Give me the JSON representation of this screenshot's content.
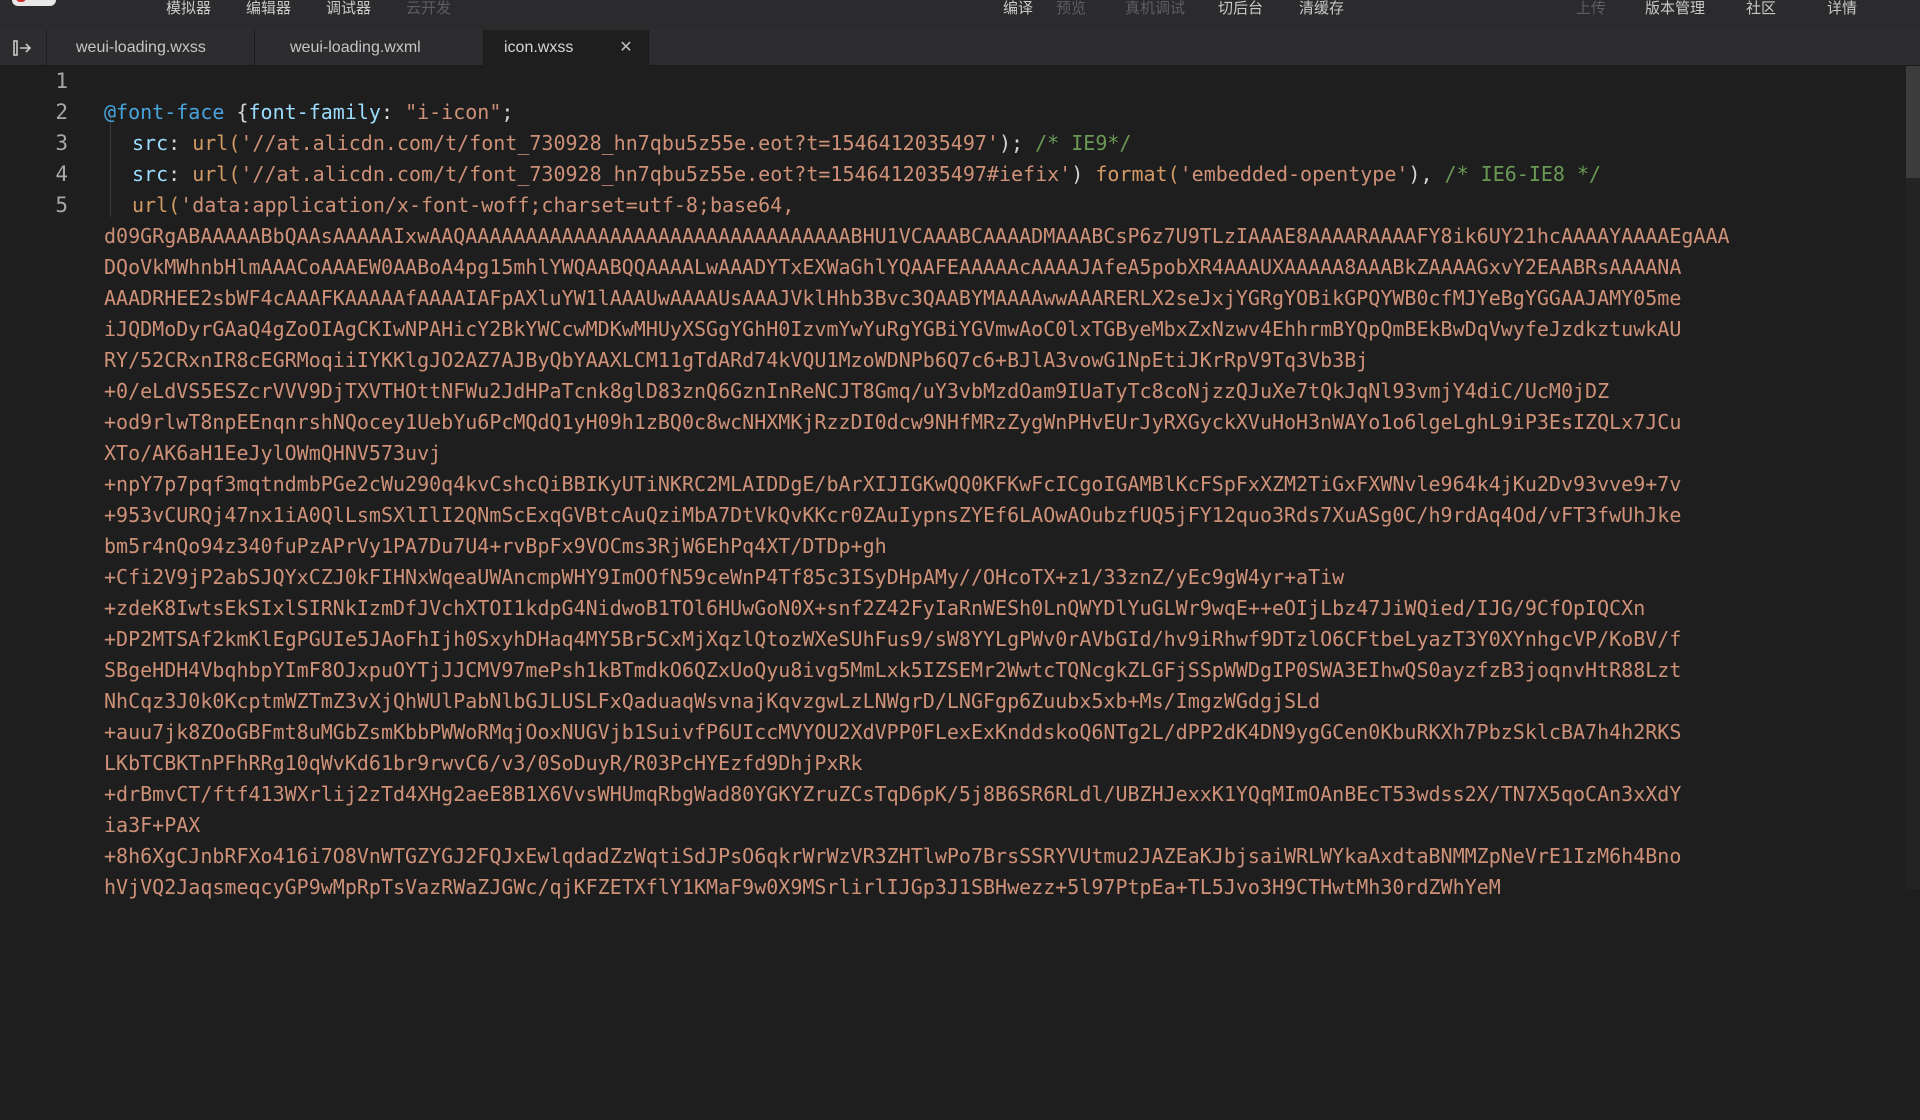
{
  "toolbar": {
    "items": [
      {
        "label": "模拟器",
        "enabled": true
      },
      {
        "label": "编辑器",
        "enabled": true
      },
      {
        "label": "调试器",
        "enabled": true
      },
      {
        "label": "云开发",
        "enabled": false
      },
      {
        "label": "编译",
        "enabled": true
      },
      {
        "label": "预览",
        "enabled": false
      },
      {
        "label": "真机调试",
        "enabled": false
      },
      {
        "label": "切后台",
        "enabled": true
      },
      {
        "label": "清缓存",
        "enabled": true
      },
      {
        "label": "上传",
        "enabled": false
      },
      {
        "label": "版本管理",
        "enabled": true
      },
      {
        "label": "社区",
        "enabled": true
      },
      {
        "label": "详情",
        "enabled": true
      }
    ]
  },
  "tabs": [
    {
      "label": "weui-loading.wxss",
      "active": false
    },
    {
      "label": "weui-loading.wxml",
      "active": false
    },
    {
      "label": "icon.wxss",
      "active": true
    }
  ],
  "tab_close_glyph": "✕",
  "line_numbers": [
    "1",
    "2",
    "3",
    "4",
    "5"
  ],
  "code": {
    "line2": {
      "at": "@font-face",
      "brace": " {",
      "prop": "font-family",
      "colon": ": ",
      "value": "\"i-icon\"",
      "end": ";"
    },
    "line3": {
      "prop": "src",
      "colon": ": ",
      "fn": "url(",
      "str": "'//at.alicdn.com/t/font_730928_hn7qbu5z55e.eot?t=1546412035497'",
      "close": "); ",
      "comment": "/* IE9*/"
    },
    "line4": {
      "prop": "src",
      "colon": ": ",
      "fn": "url(",
      "str": "'//at.alicdn.com/t/font_730928_hn7qbu5z55e.eot?t=1546412035497#iefix'",
      "close": ") ",
      "fn2": "format(",
      "str2": "'embedded-opentype'",
      "close2": "), ",
      "comment": "/* IE6-IE8 */"
    },
    "line5": {
      "fn": "url(",
      "str": "'data:application/x-font-woff;charset=utf-8;base64,"
    },
    "base64": [
      "d09GRgABAAAAABbQAAsAAAAAIxwAAQAAAAAAAAAAAAAAAAAAAAAAAAAAAAAAAABHU1VCAAABCAAAADMAAABCsP6z7U9TLzIAAAE8AAAARAAAAFY8ik6UY21hcAAAAYAAAAEgAAA",
      "DQoVkMWhnbHlmAAACoAAAEW0AABoA4pg15mhlYWQAABQQAAAALwAAADYTxEXWaGhlYQAAFEAAAAAcAAAAJAfeA5pobXR4AAAUXAAAAA8AAABkZAAAAGxvY2EAABRsAAAANA",
      "AAADRHEE2sbWF4cAAAFKAAAAAfAAAAIAFpAXluYW1lAAAUwAAAAUsAAAJVklHhb3Bvc3QAABYMAAAAwwAAARERLX2seJxjYGRgYOBikGPQYWB0cfMJYeBgYGGAAJAMY05me",
      "iJQDMoDyrGAaQ4gZoOIAgCKIwNPAHicY2BkYWCcwMDKwMHUyXSGgYGhH0IzvmYwYuRgYGBiYGVmwAoC0lxTGByeMbxZxNzwv4EhhrmBYQpQmBEkBwDqVwyfeJzdkztuwkAU",
      "RY/52CRxnIR8cEGRMoqiiIYKKlgJO2AZ7AJByQbYAAXLCM11gTdARd74kVQU1MzoWDNPb6Q7c6+BJlA3vowG1NpEtiJKrRpV9Tq3Vb3Bj",
      "+0/eLdVS5ESZcrVVV9DjTXVTHOttNFWu2JdHPaTcnk8glD83znQ6GznInReNCJT8Gmq/uY3vbMzdOam9IUaTyTc8coNjzzQJuXe7tQkJqNl93vmjY4diC/UcM0jDZ",
      "+od9rlwT8npEEnqnrshNQocey1UebYu6PcMQdQ1yH09h1zBQ0c8wcNHXMKjRzzDI0dcw9NHfMRzZygWnPHvEUrJyRXGyckXVuHoH3nWAYo1o6lgeLghL9iP3EsIZQLx7JCu",
      "XTo/AK6aH1EeJylOWmQHNV573uvj",
      "+npY7p7pqf3mqtndmbPGe2cWu290q4kvCshcQiBBIKyUTiNKRC2MLAIDDgE/bArXIJIGKwQQ0KFKwFcICgoIGAMBlKcFSpFxXZM2TiGxFXWNvle964k4jKu2Dv93vve9+7v",
      "+953vCURQj47nx1iA0QlLsmSXlIlI2QNmScExqGVBtcAuQziMbA7DtVkQvKKcr0ZAuIypnsZYEf6LAOwAOubzfUQ5jFY12quo3Rds7XuASg0C/h9rdAq4Od/vFT3fwUhJke",
      "bm5r4nQo94z340fuPzAPrVy1PA7Du7U4+rvBpFx9VOCms3RjW6EhPq4XT/DTDp+gh",
      "+Cfi2V9jP2abSJQYxCZJ0kFIHNxWqeaUWAncmpWHY9ImOOfN59ceWnP4Tf85c3ISyDHpAMy//OHcoTX+z1/33znZ/yEc9gW4yr+aTiw",
      "+zdeK8IwtsEkSIxlSIRNkIzmDfJVchXTOI1kdpG4NidwoB1TOl6HUwGoN0X+snf2Z42FyIaRnWESh0LnQWYDlYuGLWr9wqE++eOIjLbz47JiWQied/IJG/9CfOpIQCXn",
      "+DP2MTSAf2kmKlEgPGUIe5JAoFhIjh0SxyhDHaq4MY5Br5CxMjXqzlQtozWXeSUhFus9/sW8YYLgPWv0rAVbGId/hv9iRhwf9DTzlO6CFtbeLyazT3Y0XYnhgcVP/KoBV/f",
      "SBgeHDH4VbqhbpYImF8OJxpuOYTjJJCMV97mePsh1kBTmdkO6QZxUoQyu8ivg5MmLxk5IZSEMr2WwtcTQNcgkZLGFjSSpWWDgIP0SWA3EIhwQS0ayzfzB3joqnvHtR88Lzt",
      "NhCqz3J0k0KcptmWZTmZ3vXjQhWUlPabNlbGJLUSLFxQaduaqWsvnajKqvzgwLzLNWgrD/LNGFgp6Zuubx5xb+Ms/ImgzWGdgjSLd",
      "+auu7jk8ZOoGBFmt8uMGbZsmKbbPWWoRMqjOoxNUGVjb1SuivfP6UIccMVYOU2XdVPP0FLexExKnddskoQ6NTg2L/dPP2dK4DN9ygGCen0KbuRKXh7PbzSklcBA7h4h2RKS",
      "LKbTCBKTnPFhRRg10qWvKd61br9rwvC6/v3/0SoDuyR/R03PcHYEzfd9DhjPxRk",
      "+drBmvCT/ftf413WXrlij2zTd4XHg2aeE8B1X6VvsWHUmqRbgWad80YGKYZruZCsTqD6pK/5j8B6SR6RLdl/UBZHJexxK1YQqMImOAnBEcT53wdss2X/TN7X5qoCAn3xXdY",
      "ia3F+PAX",
      "+8h6XgCJnbRFXo416i7O8VnWTGZYGJ2FQJxEwlqdadZzWqtiSdJPsO6qkrWrWzVR3ZHTlwPo7BrsSSRYVUtmu2JAZEaKJbjsaiWRLWYkaAxdtaBNMMZpNeVrE1IzM6h4Bno",
      "hVjVQ2JaqsmeqcyGP9wMpRpTsVazRWaZJGWc/qjKFZETXflY1KMaF9w0X9MSrlirlIJGp3J1SBHwezz+5l97PtpEa+TL5Jvo3H9CTHwtMh30rdZWhYeM"
    ]
  }
}
